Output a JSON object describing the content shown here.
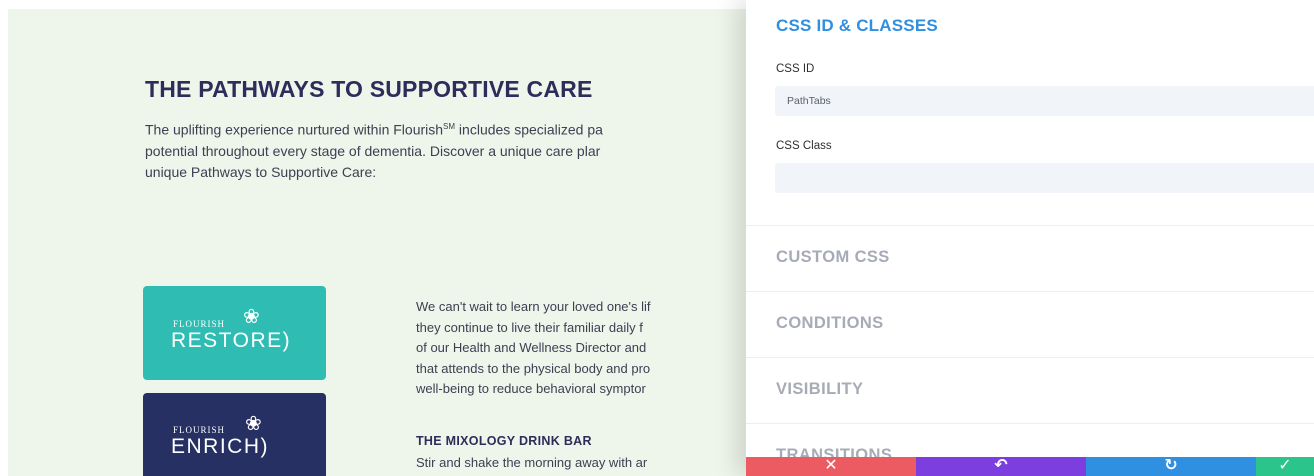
{
  "preview": {
    "title": "THE PATHWAYS TO SUPPORTIVE CARE",
    "intro_lines": [
      "The uplifting experience nurtured within Flourish",
      "potential throughout every stage of dementia. Discover a unique care plar",
      "unique Pathways to Supportive Care:"
    ],
    "intro_line1_tail": " includes specialized pa",
    "service_mark": "SM",
    "logos": [
      {
        "small": "FLOURISH",
        "big": "RESTORE)",
        "color": "#2fbdb3"
      },
      {
        "small": "FLOURISH",
        "big": "ENRICH)",
        "color": "#263063"
      }
    ],
    "body_lines": [
      "We can't wait to learn your loved one's lif",
      "they continue to live their familiar daily f",
      "of our Health and Wellness Director and",
      "that attends to the physical body and pro",
      "well-being to reduce behavioral symptor"
    ],
    "mixology_title": "THE MIXOLOGY DRINK BAR",
    "mixology_text": "Stir and shake the morning away with ar"
  },
  "panel": {
    "section_title": "CSS ID & CLASSES",
    "css_id_label": "CSS ID",
    "css_id_value": "PathTabs",
    "css_class_label": "CSS Class",
    "css_class_value": "",
    "toggles": [
      "CUSTOM CSS",
      "CONDITIONS",
      "VISIBILITY",
      "TRANSITIONS"
    ],
    "actions": [
      {
        "name": "discard",
        "icon": "close-icon",
        "glyph": "✕",
        "color": "#ec5b61"
      },
      {
        "name": "history",
        "icon": "undo-icon",
        "glyph": "↶",
        "color": "#7d3ee0"
      },
      {
        "name": "redo",
        "icon": "redo-icon",
        "glyph": "↻",
        "color": "#2f8fe0"
      },
      {
        "name": "save",
        "icon": "check-icon",
        "glyph": "✓",
        "color": "#2bc48a"
      }
    ]
  },
  "colors": {
    "accent_blue": "#2f8fe0",
    "heading_navy": "#2b2d5a",
    "preview_bg": "#eef5ea",
    "toggle_grey": "#a6abb6"
  }
}
